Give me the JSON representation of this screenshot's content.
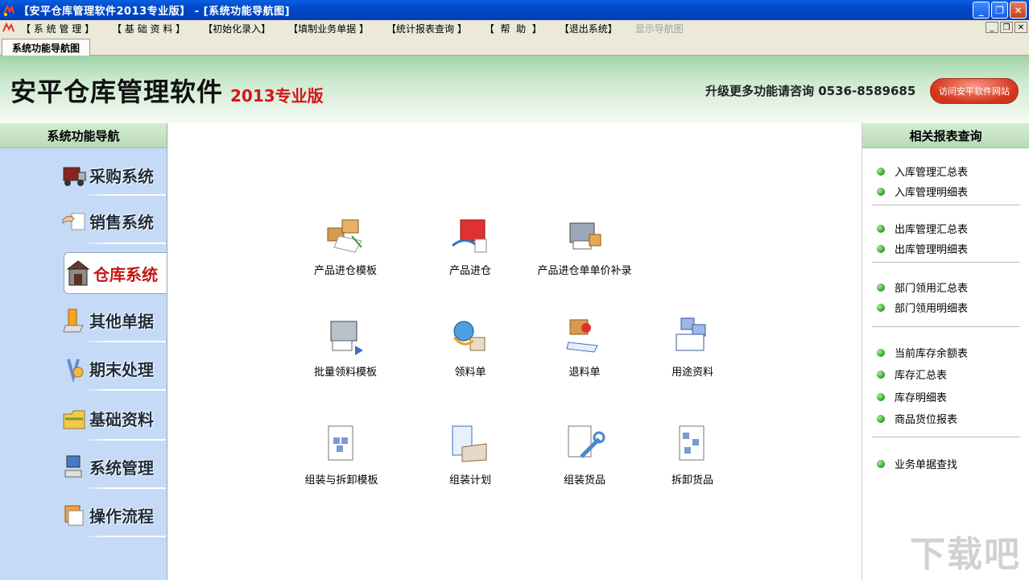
{
  "window": {
    "title": "【安平仓库管理软件2013专业版】 - [系统功能导航图]",
    "minimize": "_",
    "maximize": "❐",
    "close": "✕"
  },
  "menu": {
    "items": [
      "【 系 统 管 理 】",
      "【 基 础 资 料 】",
      "【初始化录入】",
      "【填制业务单据 】",
      "【统计报表查询 】",
      "【  帮  助  】",
      "【退出系统】",
      "显示导航图"
    ],
    "mdi_min": "_",
    "mdi_restore": "❐",
    "mdi_close": "✕"
  },
  "tab": {
    "label": "系统功能导航图"
  },
  "header": {
    "brand": "安平仓库管理软件",
    "edition": "2013专业版",
    "contact": "升级更多功能请咨询  0536-8589685",
    "visit_button": "访问安平软件网站"
  },
  "left_nav": {
    "title": "系统功能导航",
    "items": [
      {
        "label": "采购系统",
        "icon": "truck-icon"
      },
      {
        "label": "销售系统",
        "icon": "hand-card-icon"
      },
      {
        "label": "仓库系统",
        "icon": "warehouse-icon"
      },
      {
        "label": "其他单据",
        "icon": "document-stack-icon"
      },
      {
        "label": "期末处理",
        "icon": "tools-icon"
      },
      {
        "label": "基础资料",
        "icon": "folder-icon"
      },
      {
        "label": "系统管理",
        "icon": "computer-icon"
      },
      {
        "label": "操作流程",
        "icon": "flow-icon"
      }
    ],
    "active_index": 2
  },
  "functions": {
    "row1": [
      {
        "label": "产品进仓模板",
        "icon": "boxes-template-icon"
      },
      {
        "label": "产品进仓",
        "icon": "factory-inbound-icon"
      },
      {
        "label": "产品进仓单单价补录",
        "icon": "printer-box-icon"
      }
    ],
    "row2": [
      {
        "label": "批量领料模板",
        "icon": "printer-arrow-icon"
      },
      {
        "label": "领料单",
        "icon": "globe-box-icon"
      },
      {
        "label": "退料单",
        "icon": "return-box-icon"
      },
      {
        "label": "用途资料",
        "icon": "blocks-document-icon"
      }
    ],
    "row3": [
      {
        "label": "组装与拆卸模板",
        "icon": "assembly-template-icon"
      },
      {
        "label": "组装计划",
        "icon": "plan-box-icon"
      },
      {
        "label": "组装货品",
        "icon": "wrench-document-icon"
      },
      {
        "label": "拆卸货品",
        "icon": "disassemble-document-icon"
      }
    ]
  },
  "reports": {
    "title": "相关报表查询",
    "groups": [
      [
        "入库管理汇总表",
        "入库管理明细表"
      ],
      [
        "出库管理汇总表",
        "出库管理明细表"
      ],
      [
        "部门领用汇总表",
        "部门领用明细表"
      ],
      [
        "当前库存余额表",
        "库存汇总表",
        "库存明细表",
        "商品货位报表"
      ],
      [
        "业务单据查找"
      ]
    ]
  },
  "watermark": "下载吧",
  "colors": {
    "titlebar": "#0048c8",
    "banner_green": "#9fd3a6",
    "nav_bg": "#c4daf6",
    "edition_red": "#d8141c",
    "active_nav_text": "#c01818",
    "report_dot": "#2a9a24"
  }
}
